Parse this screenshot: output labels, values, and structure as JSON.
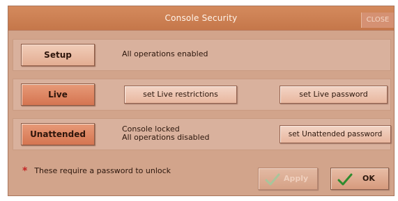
{
  "window": {
    "title": "Console Security",
    "close_label": "CLOSE"
  },
  "modes": {
    "setup": {
      "label": "Setup",
      "status": "All operations enabled"
    },
    "live": {
      "label": "Live",
      "restrictions_button": "set Live restrictions",
      "password_button": "set Live password"
    },
    "unattended": {
      "label": "Unattended",
      "status_line1": "Console locked",
      "status_line2": "All operations disabled",
      "password_button": "set Unattended password"
    }
  },
  "footer": {
    "note_marker": "*",
    "note": "These require a password to unlock",
    "apply_label": "Apply",
    "ok_label": "OK"
  },
  "colors": {
    "title_bar": "#c97d50",
    "dialog_background": "#d2a48b",
    "mode_active": "#dc8461",
    "asterisk": "#c42323",
    "ok_check": "#2e8b2e",
    "apply_check_disabled": "#a8c59b"
  },
  "icons": {
    "apply": "checkmark",
    "ok": "checkmark"
  }
}
